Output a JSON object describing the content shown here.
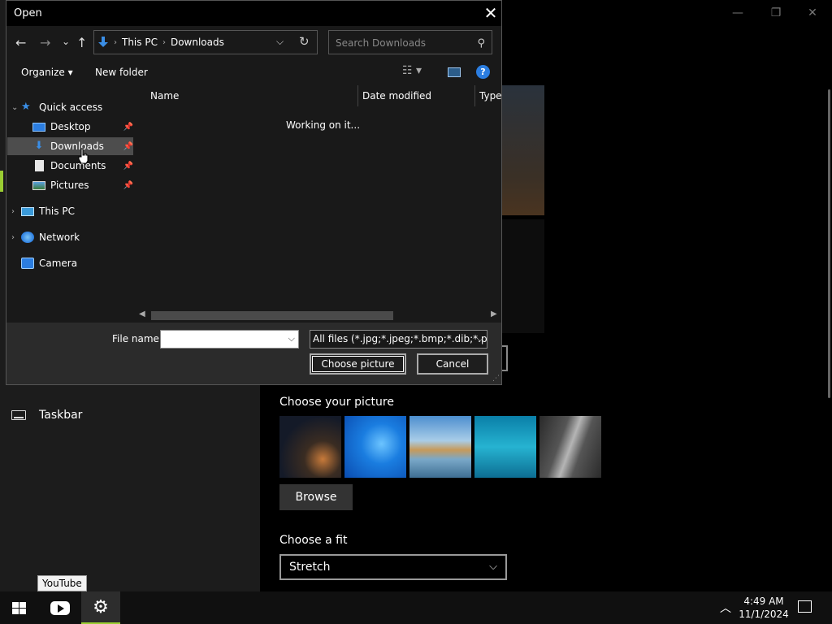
{
  "dialog": {
    "title": "Open",
    "close_glyph": "✕",
    "nav": {
      "back": "←",
      "forward": "→",
      "recent": "⌄",
      "up": "↑"
    },
    "address": {
      "segments": [
        "This PC",
        "Downloads"
      ],
      "separator": "›"
    },
    "search_placeholder": "Search Downloads",
    "toolbar": {
      "organize": "Organize",
      "new_folder": "New folder",
      "dropdown_glyph": "▾",
      "help": "?"
    },
    "nav_pane": {
      "quick_access": "Quick access",
      "items": [
        {
          "label": "Desktop",
          "icon": "desktop-icon",
          "pinned": true
        },
        {
          "label": "Downloads",
          "icon": "downloads-icon",
          "pinned": true,
          "selected": true
        },
        {
          "label": "Documents",
          "icon": "documents-icon",
          "pinned": true
        },
        {
          "label": "Pictures",
          "icon": "pictures-icon",
          "pinned": true
        }
      ],
      "roots": [
        {
          "label": "This PC",
          "icon": "this-pc-icon"
        },
        {
          "label": "Network",
          "icon": "network-icon"
        },
        {
          "label": "Camera",
          "icon": "camera-icon"
        }
      ]
    },
    "columns": [
      "Name",
      "Date modified",
      "Type"
    ],
    "status_text": "Working on it...",
    "file_name_label": "File name:",
    "file_name_value": "",
    "file_type_filter": "All files (*.jpg;*.jpeg;*.bmp;*.dib;*.png",
    "choose_button": "Choose picture",
    "cancel_button": "Cancel"
  },
  "settings": {
    "taskbar_label": "Taskbar",
    "choose_picture_title": "Choose your picture",
    "thumbnails": [
      {
        "name": "milky-way-tent",
        "colors": [
          "#1a1f2e",
          "#5a4a3a"
        ]
      },
      {
        "name": "windows-blue",
        "colors": [
          "#0a5cc7",
          "#2fa0f5"
        ]
      },
      {
        "name": "beach-rocks",
        "colors": [
          "#7fb4d9",
          "#c79a5a"
        ]
      },
      {
        "name": "underwater-swimmer",
        "colors": [
          "#0d8fb5",
          "#36c2d9"
        ]
      },
      {
        "name": "rock-cliff",
        "colors": [
          "#3a3a3a",
          "#9a9a9a"
        ]
      }
    ],
    "browse_button": "Browse",
    "choose_fit_title": "Choose a fit",
    "fit_value": "Stretch"
  },
  "taskbar": {
    "tooltip": "YouTube",
    "time": "4:49 AM",
    "date": "11/1/2024"
  },
  "colors": {
    "accent": "#9acd32",
    "folder_blue": "#3a8ee6",
    "help_blue": "#2b7de0"
  }
}
